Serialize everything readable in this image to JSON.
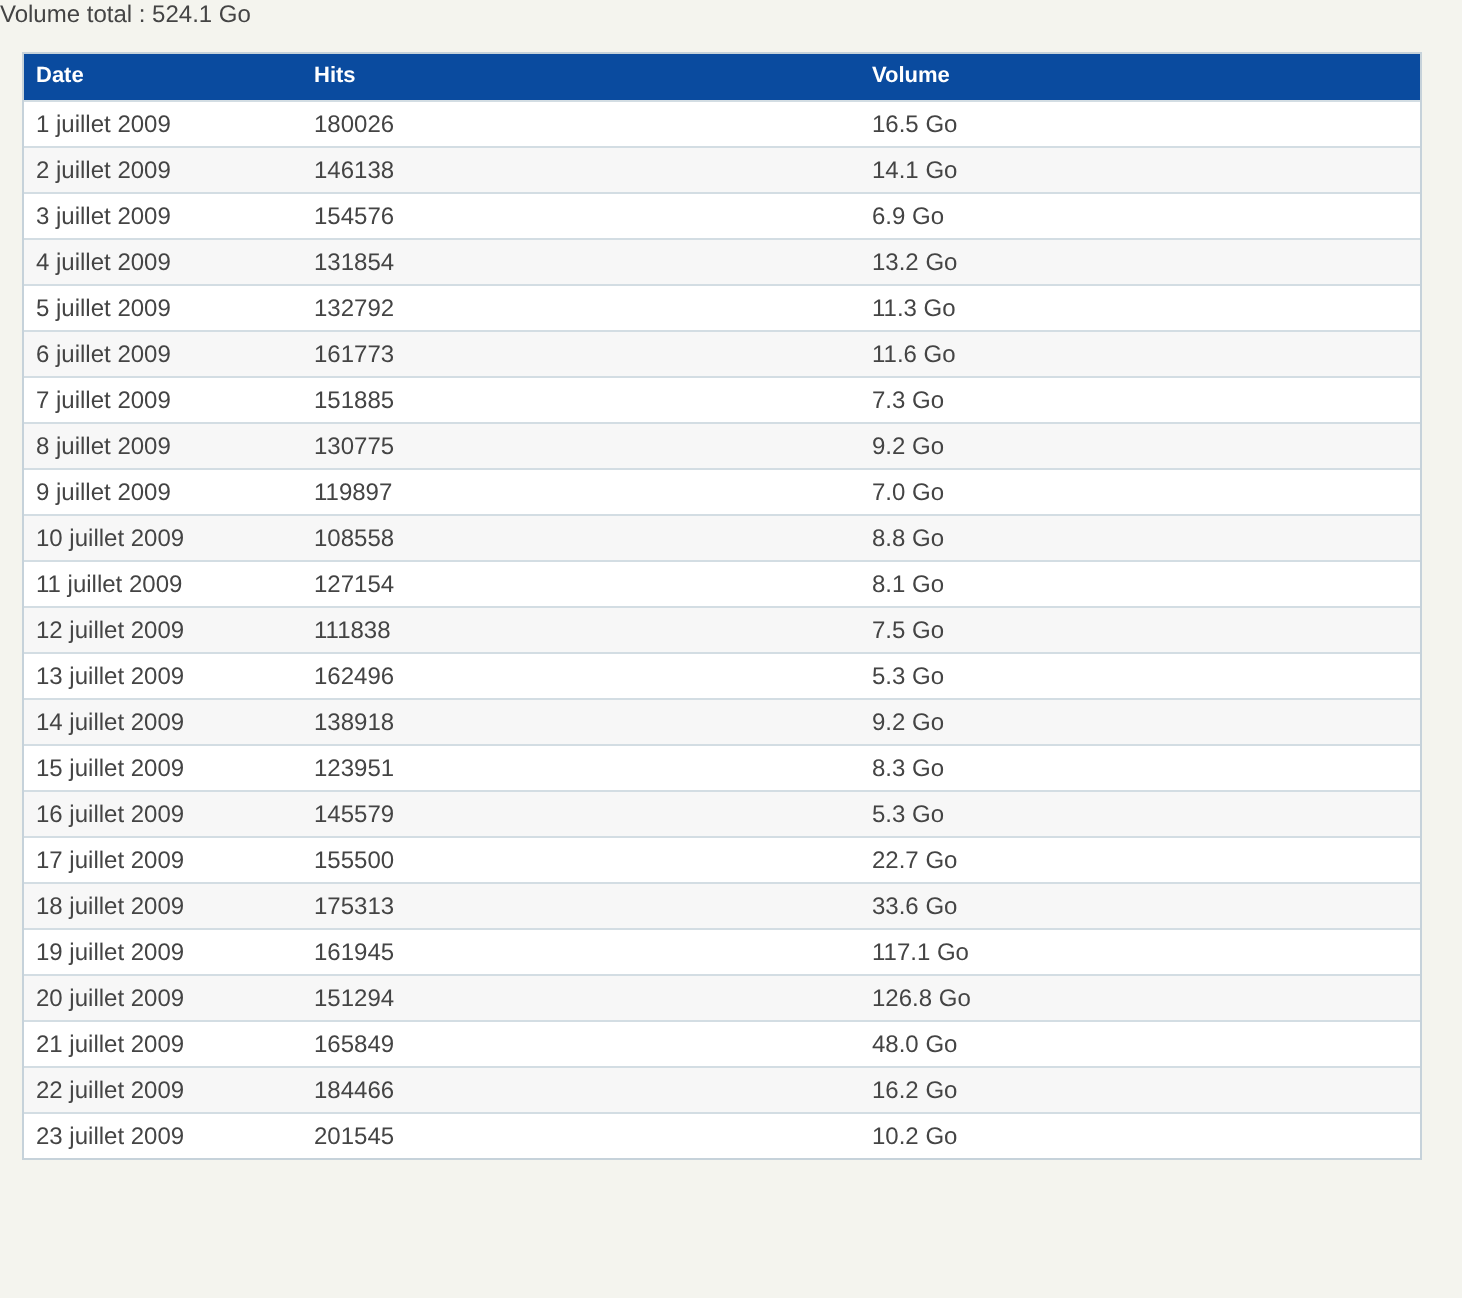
{
  "summary": "Volume total : 524.1 Go",
  "table": {
    "columns": [
      "Date",
      "Hits",
      "Volume"
    ],
    "rows": [
      [
        "1 juillet 2009",
        "180026",
        "16.5 Go"
      ],
      [
        "2 juillet 2009",
        "146138",
        "14.1 Go"
      ],
      [
        "3 juillet 2009",
        "154576",
        "6.9 Go"
      ],
      [
        "4 juillet 2009",
        "131854",
        "13.2 Go"
      ],
      [
        "5 juillet 2009",
        "132792",
        "11.3 Go"
      ],
      [
        "6 juillet 2009",
        "161773",
        "11.6 Go"
      ],
      [
        "7 juillet 2009",
        "151885",
        "7.3 Go"
      ],
      [
        "8 juillet 2009",
        "130775",
        "9.2 Go"
      ],
      [
        "9 juillet 2009",
        "119897",
        "7.0 Go"
      ],
      [
        "10 juillet 2009",
        "108558",
        "8.8 Go"
      ],
      [
        "11 juillet 2009",
        "127154",
        "8.1 Go"
      ],
      [
        "12 juillet 2009",
        "111838",
        "7.5 Go"
      ],
      [
        "13 juillet 2009",
        "162496",
        "5.3 Go"
      ],
      [
        "14 juillet 2009",
        "138918",
        "9.2 Go"
      ],
      [
        "15 juillet 2009",
        "123951",
        "8.3 Go"
      ],
      [
        "16 juillet 2009",
        "145579",
        "5.3 Go"
      ],
      [
        "17 juillet 2009",
        "155500",
        "22.7 Go"
      ],
      [
        "18 juillet 2009",
        "175313",
        "33.6 Go"
      ],
      [
        "19 juillet 2009",
        "161945",
        "117.1 Go"
      ],
      [
        "20 juillet 2009",
        "151294",
        "126.8 Go"
      ],
      [
        "21 juillet 2009",
        "165849",
        "48.0 Go"
      ],
      [
        "22 juillet 2009",
        "184466",
        "16.2 Go"
      ],
      [
        "23 juillet 2009",
        "201545",
        "10.2 Go"
      ]
    ]
  }
}
